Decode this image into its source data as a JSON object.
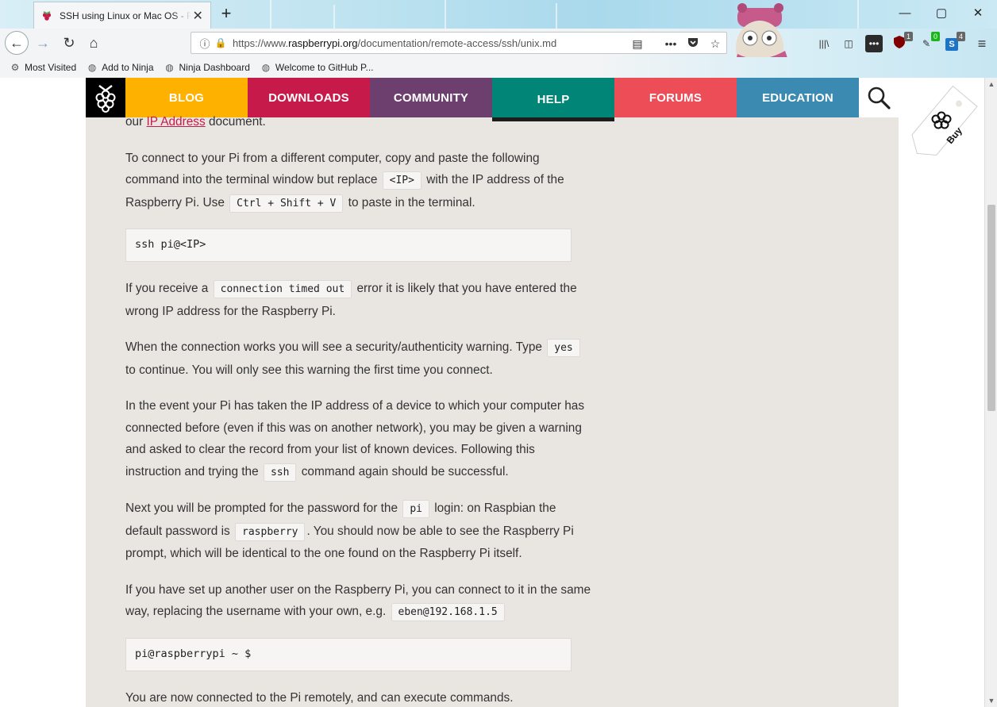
{
  "browser": {
    "tab_title": "SSH using Linux or Mac OS - Raspberry Pi Documentation",
    "url_prefix": "https://www.",
    "url_domain": "raspberrypi.org",
    "url_path": "/documentation/remote-access/ssh/unix.md",
    "bookmarks": [
      "Most Visited",
      "Add to Ninja",
      "Ninja Dashboard",
      "Welcome to GitHub P..."
    ],
    "ext_badges": [
      "1",
      "0",
      "4"
    ]
  },
  "site": {
    "nav": [
      {
        "label": "BLOG",
        "color": "#ffb100"
      },
      {
        "label": "DOWNLOADS",
        "color": "#c51a4a"
      },
      {
        "label": "COMMUNITY",
        "color": "#6c3f6f"
      },
      {
        "label": "HELP",
        "color": "#008577"
      },
      {
        "label": "FORUMS",
        "color": "#ec4d57"
      },
      {
        "label": "EDUCATION",
        "color": "#3b8ab1"
      }
    ],
    "buy_label": "Buy"
  },
  "doc": {
    "p0_pre": "our ",
    "p0_link": "IP Address",
    "p0_post": " document.",
    "p1_a": "To connect to your Pi from a different computer, copy and paste the following command into the terminal window but replace ",
    "p1_code1": "<IP>",
    "p1_b": " with the IP address of the Raspberry Pi. Use ",
    "p1_code2": "Ctrl + Shift + V",
    "p1_c": " to paste in the terminal.",
    "block1": "ssh pi@<IP>",
    "p2_a": "If you receive a ",
    "p2_code": "connection timed out",
    "p2_b": " error it is likely that you have entered the wrong IP address for the Raspberry Pi.",
    "p3_a": "When the connection works you will see a security/authenticity warning. Type ",
    "p3_code": "yes",
    "p3_b": " to continue. You will only see this warning the first time you connect.",
    "p4_a": "In the event your Pi has taken the IP address of a device to which your computer has connected before (even if this was on another network), you may be given a warning and asked to clear the record from your list of known devices. Following this instruction and trying the ",
    "p4_code": "ssh",
    "p4_b": " command again should be successful.",
    "p5_a": "Next you will be prompted for the password for the ",
    "p5_code1": "pi",
    "p5_b": " login: on Raspbian the default password is ",
    "p5_code2": "raspberry",
    "p5_c": ". You should now be able to see the Raspberry Pi prompt, which will be identical to the one found on the Raspberry Pi itself.",
    "p6_a": "If you have set up another user on the Raspberry Pi, you can connect to it in the same way, replacing the username with your own, e.g. ",
    "p6_code": "eben@192.168.1.5",
    "block2": "pi@raspberrypi ~ $",
    "p7": "You are now connected to the Pi remotely, and can execute commands."
  }
}
